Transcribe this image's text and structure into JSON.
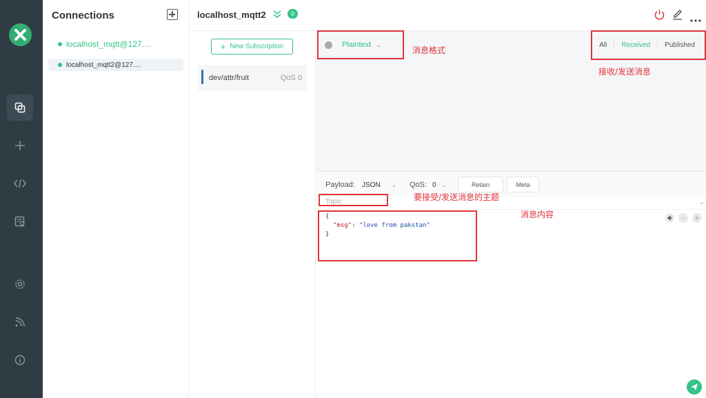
{
  "connections": {
    "title": "Connections",
    "items": [
      {
        "label": "localhost_mqtt@127...."
      },
      {
        "label": "localhost_mqtt2@127...."
      }
    ]
  },
  "header": {
    "title": "localhost_mqtt2",
    "badge": "0"
  },
  "subscriptions": {
    "new_button": "New Subscription",
    "items": [
      {
        "topic": "dev/attr/fruit",
        "qos": "QoS 0"
      }
    ]
  },
  "messages": {
    "format": "Plaintext",
    "tabs": [
      "All",
      "Received",
      "Published"
    ]
  },
  "publish": {
    "payload_label": "Payload:",
    "payload_format": "JSON",
    "qos_label": "QoS:",
    "qos_value": "0",
    "retain_label": "Retain",
    "meta_label": "Meta",
    "topic_placeholder": "Topic",
    "code_line1": "{",
    "code_key": "\"msg\"",
    "code_colon": ": ",
    "code_value": "\"love from pakstan\"",
    "code_line3": "}"
  },
  "annotations": {
    "format": "消息格式",
    "direction": "接收/发送消息",
    "topic": "要接受/发送消息的主题",
    "content": "消息内容"
  },
  "colors": {
    "accent": "#34c388",
    "rail": "#2f3c44",
    "annotation": "#e0323a"
  }
}
